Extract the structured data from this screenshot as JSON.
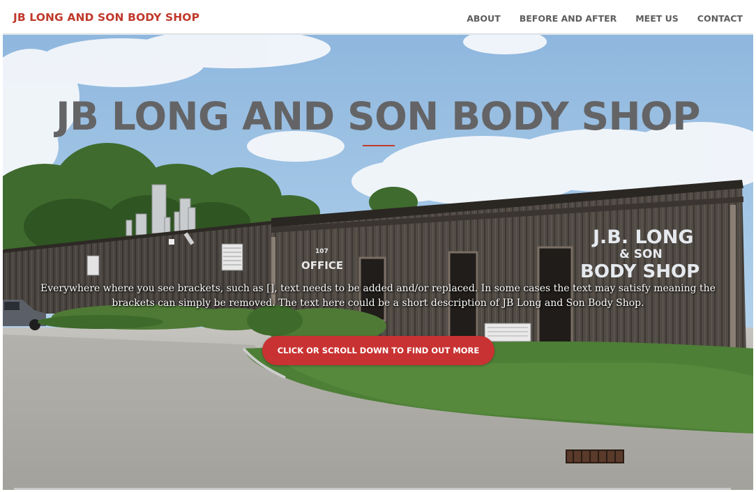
{
  "navbar": {
    "brand": "JB LONG AND SON BODY SHOP",
    "links": [
      "ABOUT",
      "BEFORE AND AFTER",
      "MEET US",
      "CONTACT"
    ]
  },
  "hero": {
    "title": "JB LONG AND SON BODY SHOP",
    "description": "Everywhere where you see brackets, such as [], text needs to be added and/or replaced. In some cases the text may satisfy meaning the brackets can simply be removed. The text here could be a short description of JB Long and Son Body Shop.",
    "cta_label": "CLICK OR SCROLL DOWN TO FIND OUT MORE"
  },
  "background_photo": {
    "building_sign": [
      "J.B. LONG",
      "& SON",
      "BODY SHOP"
    ],
    "office_sign": "OFFICE",
    "address_number": "107"
  },
  "colors": {
    "accent": "#c0392b",
    "cta": "#c93232",
    "title": "#646466",
    "nav_text": "#5d5d5d"
  }
}
